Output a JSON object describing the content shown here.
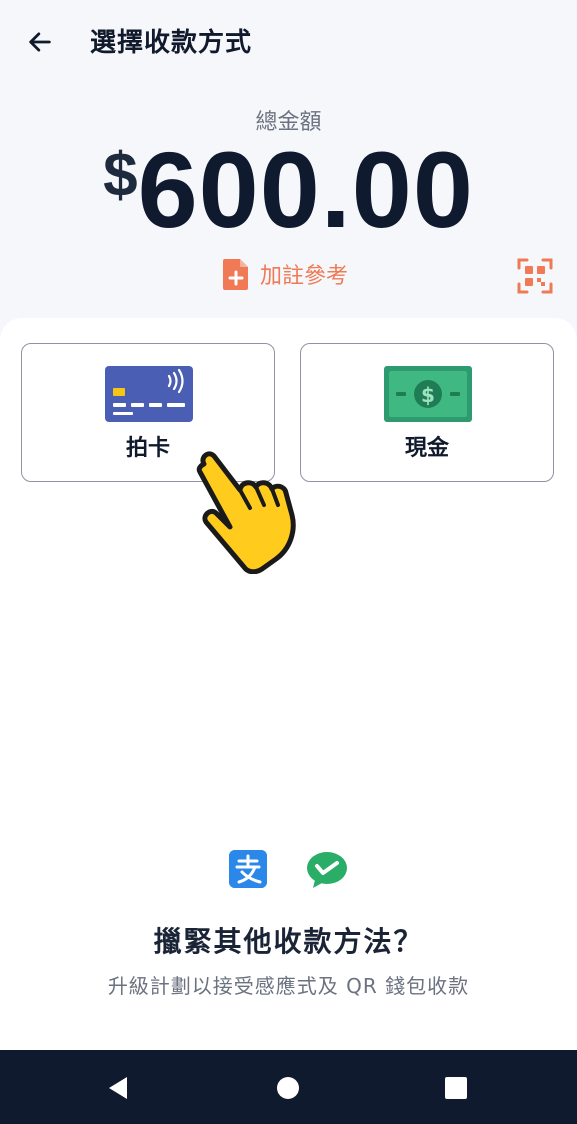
{
  "header": {
    "title": "選擇收款方式",
    "back_icon": "arrow-left-icon"
  },
  "summary": {
    "total_label": "總金額",
    "currency_symbol": "$",
    "amount": "600.00"
  },
  "actions": {
    "add_note_label": "加註參考",
    "add_note_icon": "file-plus-icon",
    "scan_icon": "qr-scan-icon",
    "accent_color": "#ef7a55"
  },
  "payment_methods": [
    {
      "label": "拍卡",
      "icon": "contactless-card-icon"
    },
    {
      "label": "現金",
      "icon": "cash-note-icon"
    }
  ],
  "promo": {
    "icons": [
      "alipay-icon",
      "wechat-pay-icon"
    ],
    "title": "擸緊其他收款方法？",
    "subtitle": "升級計劃以接受感應式及 QR 錢包收款"
  },
  "navigation": {
    "back": "nav-back-icon",
    "home": "nav-home-icon",
    "recents": "nav-recents-icon"
  }
}
